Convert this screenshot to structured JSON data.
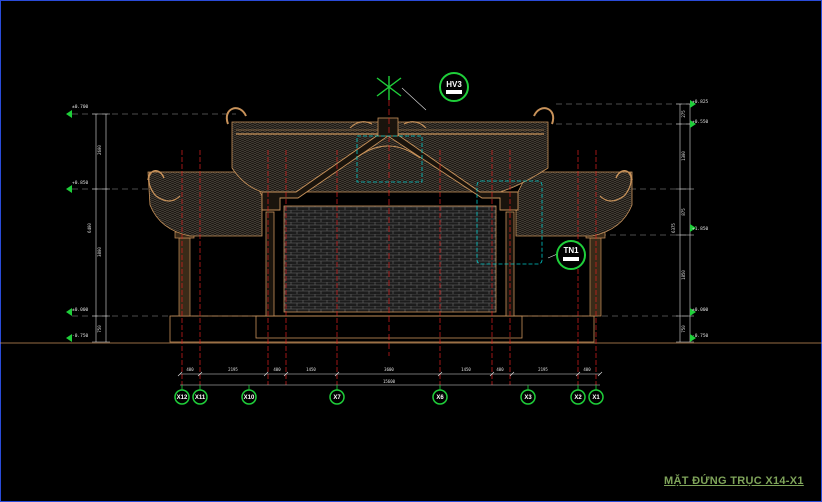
{
  "title": "MẶT ĐỨNG TRỤC X14-X1",
  "tags": {
    "hv": "HV3",
    "tn": "TN1"
  },
  "axes": [
    "X12",
    "X11",
    "X10",
    "X7",
    "X6",
    "X3",
    "X2",
    "X1"
  ],
  "colors": {
    "background": "#000000",
    "frame": "#2a4bd8",
    "roof": "#c8925a",
    "column_line": "#e02020",
    "dimension": "#e0e0e0",
    "tag_green": "#1fcf3a",
    "callout": "#00c8c8",
    "title": "#7fa45a"
  }
}
